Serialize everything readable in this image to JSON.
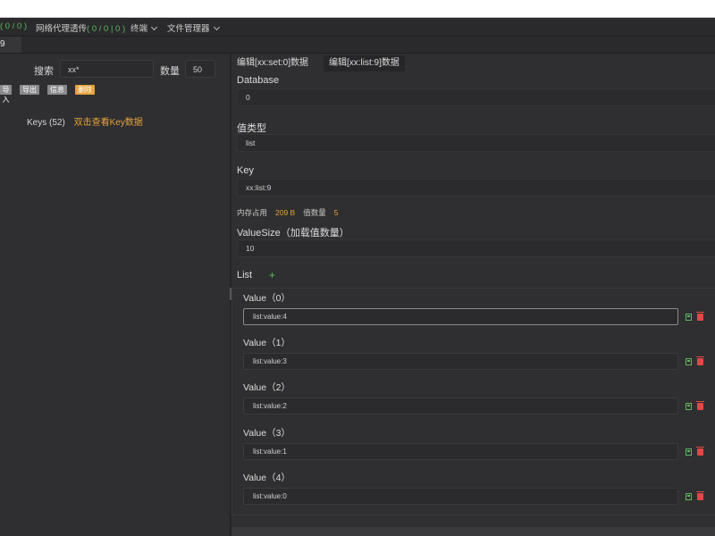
{
  "menubar": {
    "count1": "( 0 / 0 )",
    "proxy_label": "网络代理透传",
    "proxy_count": "( 0 / 0 | 0 )",
    "terminal": "终端",
    "file_manager": "文件管理器"
  },
  "main_tab": {
    "label": "9"
  },
  "left": {
    "search_label": "搜索",
    "search_value": "xx*",
    "count_label": "数量",
    "count_value": "50",
    "buttons": {
      "import": "导入",
      "export": "导出",
      "info": "信息",
      "delete": "删除"
    },
    "keys_label": "Keys",
    "keys_count": "(52)",
    "keys_hint": "双击查看Key数据"
  },
  "editor": {
    "tabs": [
      "编辑[xx:set:0]数据",
      "编辑[xx:list:9]数据"
    ],
    "database_label": "Database",
    "database_value": "0",
    "type_label": "值类型",
    "type_value": "list",
    "key_label": "Key",
    "key_value": "xx:list:9",
    "mem_label": "内存占用",
    "mem_value": "209 B",
    "count_label": "值数量",
    "count_value": "5",
    "valuesize_label": "ValueSize（加载值数量）",
    "valuesize_value": "10",
    "list_title": "List",
    "add_icon": "+",
    "items": [
      {
        "label": "Value（0）",
        "value": "list:value:4"
      },
      {
        "label": "Value（1）",
        "value": "list:value:3"
      },
      {
        "label": "Value（2）",
        "value": "list:value:2"
      },
      {
        "label": "Value（3）",
        "value": "list:value:1"
      },
      {
        "label": "Value（4）",
        "value": "list:value:0"
      }
    ]
  },
  "icons": {
    "chevron": "chevron-down-icon",
    "save": "save-icon",
    "delete": "trash-icon",
    "add": "plus-icon"
  },
  "colors": {
    "accent": "#e6a23c",
    "success": "#5cb85c",
    "danger": "#e04848",
    "bg": "#2f2f31"
  }
}
